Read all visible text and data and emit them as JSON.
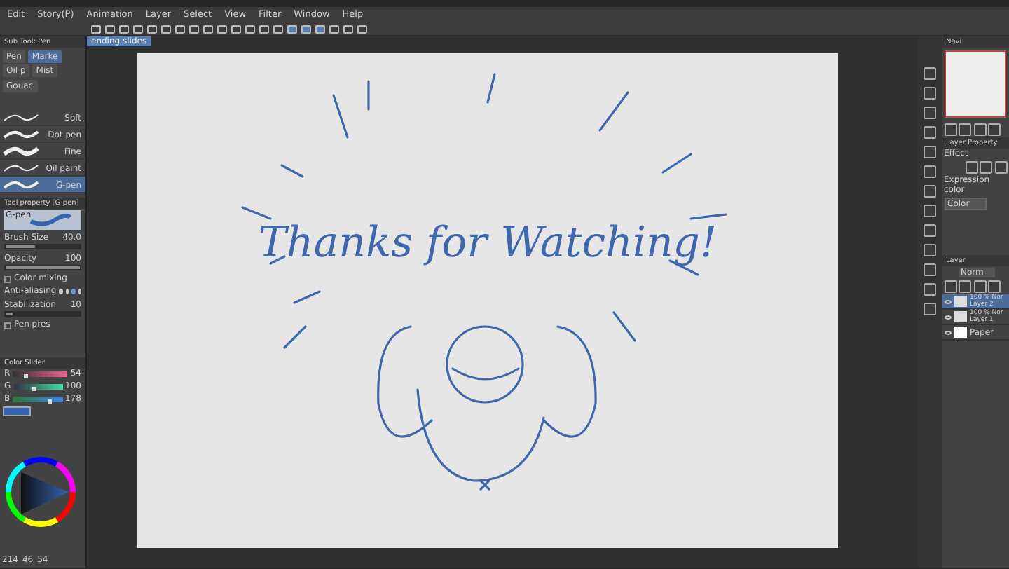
{
  "menu": [
    "Edit",
    "Story(P)",
    "Animation",
    "Layer",
    "Select",
    "View",
    "Filter",
    "Window",
    "Help"
  ],
  "document_tab": {
    "label": "ending slides",
    "selected": true
  },
  "sub_tool_panel": {
    "title": "Sub Tool: Pen",
    "groups": [
      {
        "label": "Pen",
        "selected": false
      },
      {
        "label": "Marke",
        "selected": true
      },
      {
        "label": "Oil p",
        "selected": false
      },
      {
        "label": "Mist",
        "selected": false
      },
      {
        "label": "Gouac",
        "selected": false
      }
    ],
    "brushes": [
      {
        "label": "Soft",
        "selected": false
      },
      {
        "label": "Dot pen",
        "selected": false
      },
      {
        "label": "Fine",
        "selected": false
      },
      {
        "label": "Oil paint",
        "selected": false
      },
      {
        "label": "G-pen",
        "selected": true
      }
    ]
  },
  "tool_property": {
    "title": "Tool property [G-pen]",
    "preview_label": "G-pen",
    "rows": [
      {
        "kind": "slider",
        "label": "Brush Size",
        "value": "40.0",
        "level": 0.4
      },
      {
        "kind": "slider",
        "label": "Opacity",
        "value": "100",
        "level": 1
      },
      {
        "kind": "check",
        "label": "Color mixing",
        "checked": false
      },
      {
        "kind": "shapes",
        "label": "Anti-aliasing",
        "options": [
          {
            "selected": false
          },
          {
            "selected": false
          },
          {
            "selected": true
          },
          {
            "selected": false
          }
        ]
      },
      {
        "kind": "slider",
        "label": "Stabilization",
        "value": "10",
        "level": 0.1
      },
      {
        "kind": "check",
        "label": "Pen pres",
        "checked": false
      }
    ]
  },
  "color_slider": {
    "title": "Color Slider",
    "channels": [
      {
        "name": "R",
        "value": "54",
        "level": 0.21
      },
      {
        "name": "G",
        "value": "100",
        "level": 0.39
      },
      {
        "name": "B",
        "value": "178",
        "level": 0.7
      }
    ]
  },
  "status_bar": [
    "214",
    "46",
    "54"
  ],
  "canvas": {
    "heading": "Thanks for Watching!"
  },
  "navigator": {
    "title": "Navi"
  },
  "layer_property": {
    "title": "Layer Property",
    "effect_label": "Effect",
    "expression_label": "Expression color",
    "expression_value": "Color"
  },
  "layer_panel": {
    "title": "Layer",
    "blend_mode": "Norm",
    "layers": [
      {
        "kind": "raster",
        "opacity": "100 % Nor",
        "name": "Layer 2",
        "visible": true,
        "selected": true
      },
      {
        "kind": "raster",
        "opacity": "100 % Nor",
        "name": "Layer 1",
        "visible": true,
        "selected": false
      },
      {
        "kind": "paper",
        "name": "Paper",
        "visible": true,
        "selected": false
      }
    ]
  }
}
